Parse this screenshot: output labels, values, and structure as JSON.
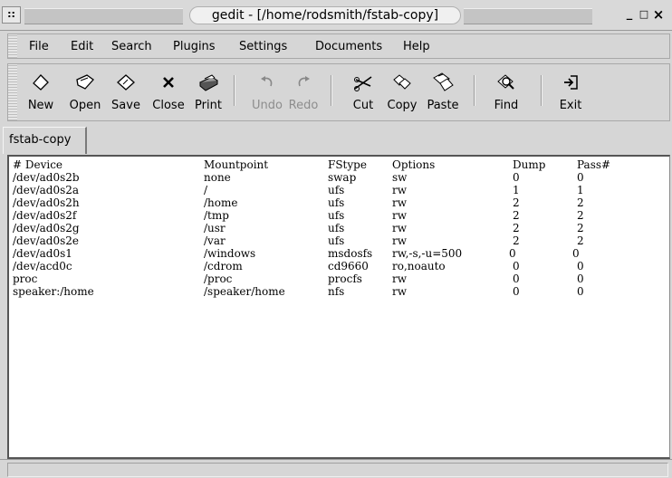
{
  "window": {
    "title": "gedit - [/home/rodsmith/fstab-copy]",
    "sysmenu_glyph": "::",
    "controls": {
      "minimize": "_",
      "maximize": "□",
      "close": "×"
    }
  },
  "menubar": {
    "items": [
      {
        "label": "File"
      },
      {
        "label": "Edit"
      },
      {
        "label": "Search"
      },
      {
        "label": "Plugins"
      },
      {
        "label": "Settings"
      },
      {
        "label": "Documents"
      },
      {
        "label": "Help"
      }
    ]
  },
  "toolbar": {
    "buttons": [
      {
        "label": "New",
        "icon": "new-document-icon",
        "enabled": true
      },
      {
        "label": "Open",
        "icon": "open-folder-icon",
        "enabled": true
      },
      {
        "label": "Save",
        "icon": "save-icon",
        "enabled": true
      },
      {
        "label": "Close",
        "icon": "close-icon",
        "enabled": true
      },
      {
        "label": "Print",
        "icon": "printer-icon",
        "enabled": true
      },
      {
        "label": "Undo",
        "icon": "undo-icon",
        "enabled": false
      },
      {
        "label": "Redo",
        "icon": "redo-icon",
        "enabled": false
      },
      {
        "label": "Cut",
        "icon": "scissors-icon",
        "enabled": true
      },
      {
        "label": "Copy",
        "icon": "copy-icon",
        "enabled": true
      },
      {
        "label": "Paste",
        "icon": "paste-icon",
        "enabled": true
      },
      {
        "label": "Find",
        "icon": "find-icon",
        "enabled": true
      },
      {
        "label": "Exit",
        "icon": "exit-icon",
        "enabled": true
      }
    ]
  },
  "tabs": [
    {
      "label": "fstab-copy",
      "active": true
    }
  ],
  "document": {
    "lines": [
      [
        "# Device",
        "Mountpoint",
        "FStype",
        "Options",
        "Dump",
        "Pass#"
      ],
      [
        "/dev/ad0s2b",
        "none",
        "swap",
        "sw",
        "0",
        "0"
      ],
      [
        "/dev/ad0s2a",
        "/",
        "ufs",
        "rw",
        "1",
        "1"
      ],
      [
        "/dev/ad0s2h",
        "/home",
        "ufs",
        "rw",
        "2",
        "2"
      ],
      [
        "/dev/ad0s2f",
        "/tmp",
        "ufs",
        "rw",
        "2",
        "2"
      ],
      [
        "/dev/ad0s2g",
        "/usr",
        "ufs",
        "rw",
        "2",
        "2"
      ],
      [
        "/dev/ad0s2e",
        "/var",
        "ufs",
        "rw",
        "2",
        "2"
      ],
      [
        "/dev/ad0s1",
        "/windows",
        "msdosfs",
        "rw,-s,-u=500",
        "0",
        "0"
      ],
      [
        "/dev/acd0c",
        "/cdrom",
        "cd9660",
        "ro,noauto",
        "0",
        "0"
      ],
      [
        "proc",
        "/proc",
        "procfs",
        "rw",
        "0",
        "0"
      ],
      [
        "speaker:/home",
        "/speaker/home",
        "nfs",
        "rw",
        "0",
        "0"
      ]
    ]
  },
  "statusbar": {
    "text": ""
  }
}
